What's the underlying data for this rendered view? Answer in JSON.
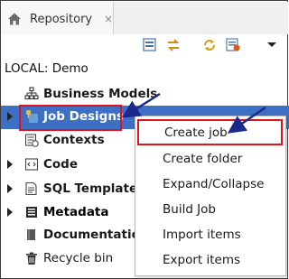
{
  "tab": {
    "title": "Repository",
    "close": "×"
  },
  "toolbar": {
    "icons": [
      "collapse-icon",
      "link-icon",
      "refresh-icon",
      "filter-icon",
      "view-menu-icon"
    ]
  },
  "root_label": "LOCAL: Demo",
  "tree": {
    "business_models": "Business Models",
    "job_designs": "Job Designs",
    "contexts": "Contexts",
    "code": "Code",
    "sql_templates": "SQL Templates",
    "metadata": "Metadata",
    "documentation": "Documentation",
    "recycle_bin": "Recycle bin"
  },
  "context_menu": {
    "create_job": "Create job",
    "create_folder": "Create folder",
    "expand_collapse": "Expand/Collapse",
    "build_job": "Build Job",
    "import_items": "Import items",
    "export_items": "Export items"
  },
  "colors": {
    "selection": "#3d6fc4",
    "annotation_red": "#e0121d",
    "annotation_arrow": "#1a2a8a"
  }
}
